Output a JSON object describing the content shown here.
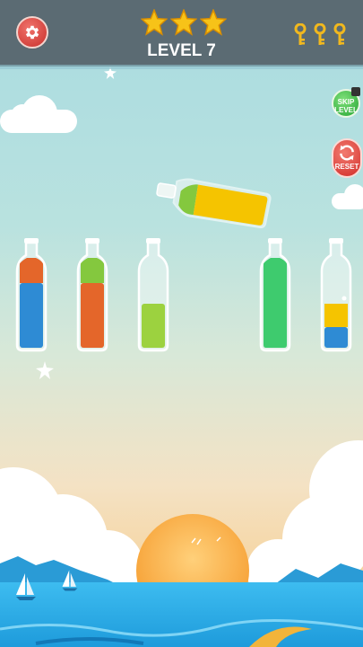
{
  "header": {
    "level_label": "LEVEL 7",
    "stars_earned": 3,
    "stars_total": 3,
    "keys_count": 3
  },
  "buttons": {
    "settings": "settings-gear-icon",
    "skip_level_line1": "SKIP",
    "skip_level_line2": "LEVEL",
    "reset": "RESET"
  },
  "colors": {
    "orange": "#e4662a",
    "blue": "#2e8bd4",
    "green": "#84c83e",
    "lime": "#9cd23f",
    "emerald": "#3ecb6e",
    "yellow": "#f5c400",
    "star": "#f7c318"
  },
  "bottles": [
    {
      "layers_bottom_up": [
        "blue",
        "blue",
        "orange"
      ]
    },
    {
      "layers_bottom_up": [
        "orange",
        "orange",
        "green"
      ]
    },
    {
      "layers_bottom_up": [
        "lime",
        "lime"
      ]
    },
    {
      "layers_bottom_up": []
    },
    {
      "layers_bottom_up": [
        "emerald",
        "emerald",
        "emerald"
      ]
    },
    {
      "layers_bottom_up": [
        "blue",
        "yellow"
      ]
    }
  ],
  "tilted_bottle": {
    "layers_bottom_up": [
      "yellow",
      "yellow",
      "green"
    ]
  }
}
